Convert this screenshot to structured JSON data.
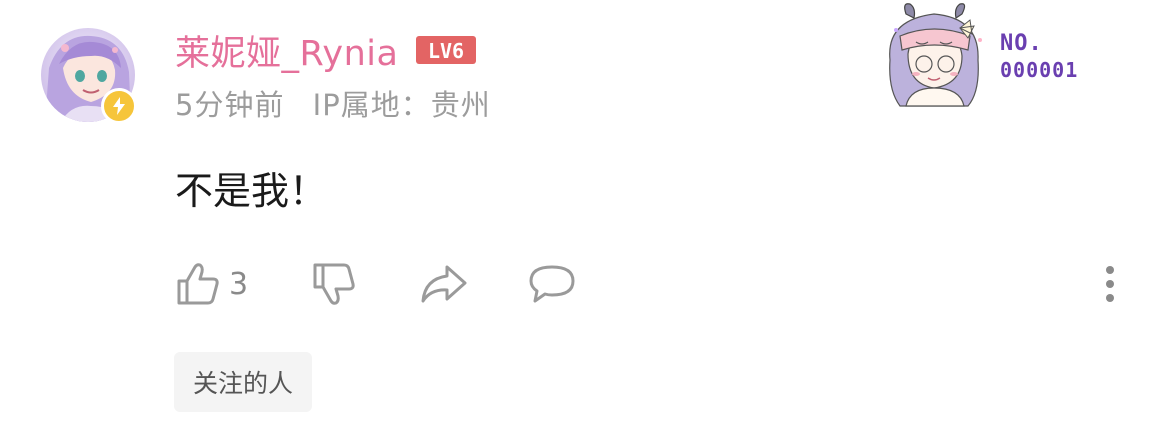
{
  "comment": {
    "username": "莱妮娅_Rynia",
    "level": "LV6",
    "time": "5分钟前",
    "ip_location": "IP属地：贵州",
    "content": "不是我！",
    "like_count": "3",
    "tag": "关注的人"
  },
  "fan_card": {
    "label": "NO.",
    "number": "000001"
  },
  "colors": {
    "username": "#e5709a",
    "level_badge": "#e36464",
    "meta": "#9c9c9c",
    "icon": "#9a9a9a",
    "vip_badge": "#f6c53a",
    "fan_number": "#6a3fb0",
    "tag_bg": "#f4f4f4"
  },
  "icons": {
    "like": "thumbs-up-icon",
    "dislike": "thumbs-down-icon",
    "share": "share-arrow-icon",
    "reply": "chat-bubble-icon",
    "more": "more-vertical-icon",
    "vip": "lightning-icon"
  }
}
